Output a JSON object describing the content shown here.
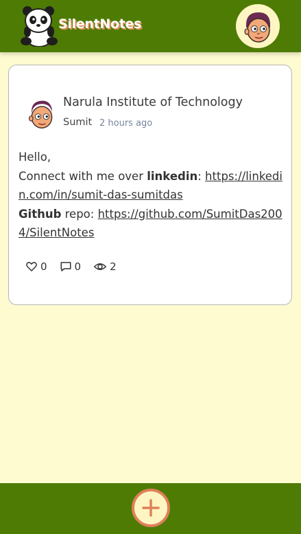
{
  "header": {
    "app_title": "SilentNotes",
    "logo_icon": "panda-logo-icon",
    "avatar_icon": "user-avatar-icon"
  },
  "note": {
    "title": "Narula Institute of Technology",
    "author": "Sumit",
    "time": "2 hours ago",
    "greeting": "Hello,",
    "line1_prefix": "Connect with me over ",
    "line1_bold": "linkedin",
    "line1_sep": ": ",
    "linkedin_url": "https://linkedin.com/in/sumit-das-sumitdas",
    "line2_bold": "Github",
    "line2_prefix": " repo: ",
    "github_url": "https://github.com/SumitDas2004/SilentNotes",
    "likes": "0",
    "comments": "0",
    "views": "2"
  },
  "footer": {
    "add_icon": "plus-icon"
  },
  "colors": {
    "header_bg": "#4e7b04",
    "page_bg": "#fffbd1",
    "title_shadow": "#e0915d",
    "add_ring": "#e0805a"
  }
}
